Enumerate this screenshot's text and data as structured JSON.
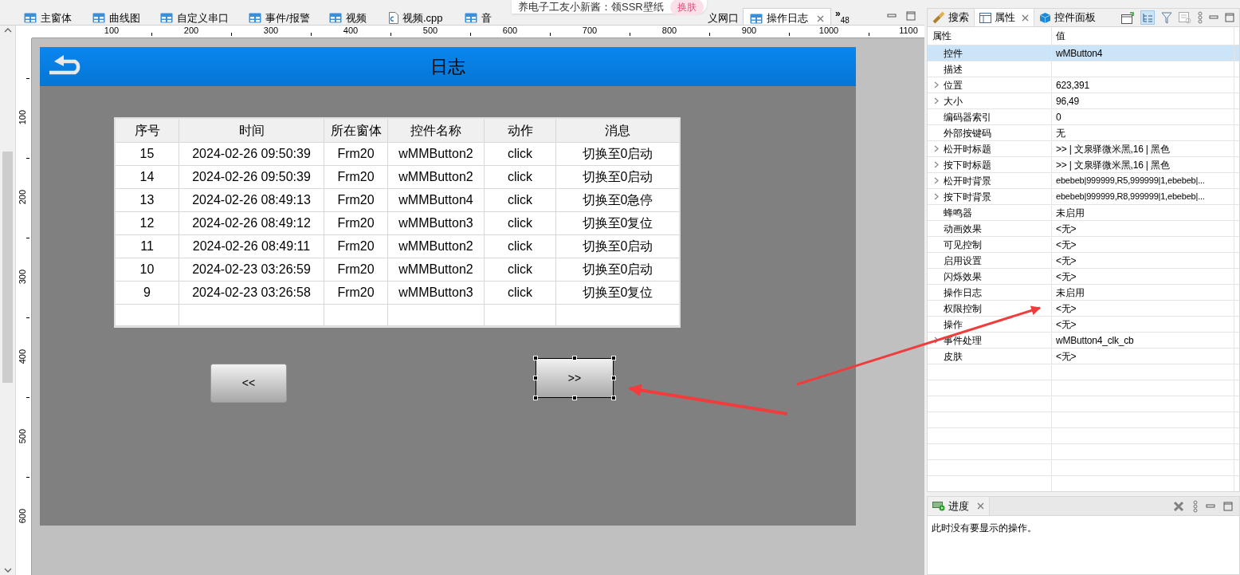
{
  "editor_tabs": [
    {
      "label": "主窗体",
      "kind": "form",
      "selected": false
    },
    {
      "label": "曲线图",
      "kind": "form",
      "selected": false
    },
    {
      "label": "自定义串口",
      "kind": "form",
      "selected": false
    },
    {
      "label": "事件/报警",
      "kind": "form",
      "selected": false
    },
    {
      "label": "视频",
      "kind": "form",
      "selected": false
    },
    {
      "label": "视频.cpp",
      "kind": "source",
      "selected": false
    },
    {
      "label": "音",
      "kind": "form",
      "selected": false
    },
    {
      "label": "义网口",
      "kind": "hidden",
      "selected": false
    },
    {
      "label": "操作日志",
      "kind": "form",
      "selected": true
    }
  ],
  "tab_overflow": {
    "arrows": "»",
    "count": "48"
  },
  "notification": {
    "text": "养电子工友小新酱：领SSR壁纸",
    "button": "换肤"
  },
  "ruler": {
    "x_labels": [
      "100",
      "200",
      "300",
      "400",
      "500",
      "600",
      "700",
      "800",
      "900",
      "1000",
      "1100"
    ],
    "y_labels": [
      "100",
      "200",
      "300",
      "400",
      "500",
      "600"
    ]
  },
  "screen": {
    "title": "日志",
    "table": {
      "columns": [
        "序号",
        "时间",
        "所在窗体",
        "控件名称",
        "动作",
        "消息"
      ],
      "rows": [
        [
          "15",
          "2024-02-26 09:50:39",
          "Frm20",
          "wMMButton2",
          "click",
          "切换至0启动"
        ],
        [
          "14",
          "2024-02-26 09:50:39",
          "Frm20",
          "wMMButton2",
          "click",
          "切换至0启动"
        ],
        [
          "13",
          "2024-02-26 08:49:13",
          "Frm20",
          "wMMButton4",
          "click",
          "切换至0急停"
        ],
        [
          "12",
          "2024-02-26 08:49:12",
          "Frm20",
          "wMMButton3",
          "click",
          "切换至0复位"
        ],
        [
          "11",
          "2024-02-26 08:49:11",
          "Frm20",
          "wMMButton2",
          "click",
          "切换至0启动"
        ],
        [
          "10",
          "2024-02-23 03:26:59",
          "Frm20",
          "wMMButton2",
          "click",
          "切换至0启动"
        ],
        [
          "9",
          "2024-02-23 03:26:58",
          "Frm20",
          "wMMButton3",
          "click",
          "切换至0复位"
        ]
      ]
    },
    "buttons": [
      {
        "label": "<<",
        "selected": false
      },
      {
        "label": ">>",
        "selected": true
      }
    ]
  },
  "properties_panel": {
    "tabs": [
      {
        "label": "搜索",
        "kind": "search",
        "selected": false
      },
      {
        "label": "属性",
        "kind": "properties",
        "selected": true
      },
      {
        "label": "控件面板",
        "kind": "palette",
        "selected": false
      }
    ],
    "columns": [
      "属性",
      "值"
    ],
    "rows": [
      {
        "name": "控件",
        "value": "wMButton4",
        "expandable": false,
        "selected": true
      },
      {
        "name": "描述",
        "expandable": false,
        "selected": false
      },
      {
        "name": "位置",
        "value": "623,391",
        "expandable": true,
        "selected": false
      },
      {
        "name": "大小",
        "value": "96,49",
        "expandable": true,
        "selected": false
      },
      {
        "name": "编码器索引",
        "value": "0",
        "expandable": false,
        "selected": false
      },
      {
        "name": "外部按键码",
        "value": "无",
        "expandable": false,
        "selected": false
      },
      {
        "name": "松开时标题",
        "value": ">> | 文泉驿微米黑,16 | 黑色",
        "expandable": true,
        "selected": false
      },
      {
        "name": "按下时标题",
        "value": ">> | 文泉驿微米黑,16 | 黑色",
        "expandable": true,
        "selected": false
      },
      {
        "name": "松开时背景",
        "value": "ebebeb|999999,R5,999999|1,ebebeb|...",
        "expandable": true,
        "selected": false
      },
      {
        "name": "按下时背景",
        "value": "ebebeb|999999,R8,999999|1,ebebeb|...",
        "expandable": true,
        "selected": false
      },
      {
        "name": "蜂鸣器",
        "value": "未启用",
        "expandable": false,
        "selected": false
      },
      {
        "name": "动画效果",
        "value": "<无>",
        "expandable": false,
        "selected": false
      },
      {
        "name": "可见控制",
        "value": "<无>",
        "expandable": false,
        "selected": false
      },
      {
        "name": "启用设置",
        "value": "<无>",
        "expandable": false,
        "selected": false
      },
      {
        "name": "闪烁效果",
        "value": "<无>",
        "expandable": false,
        "selected": false
      },
      {
        "name": "操作日志",
        "value": "未启用",
        "expandable": false,
        "selected": false
      },
      {
        "name": "权限控制",
        "value": "<无>",
        "expandable": false,
        "selected": false
      },
      {
        "name": "操作",
        "value": "<无>",
        "expandable": false,
        "selected": false
      },
      {
        "name": "事件处理",
        "value": "wMButton4_clk_cb",
        "expandable": true,
        "selected": false
      },
      {
        "name": "皮肤",
        "value": "<无>",
        "expandable": false,
        "selected": false
      }
    ]
  },
  "progress_panel": {
    "tab": "进度",
    "message": "此时没有要显示的操作。"
  }
}
